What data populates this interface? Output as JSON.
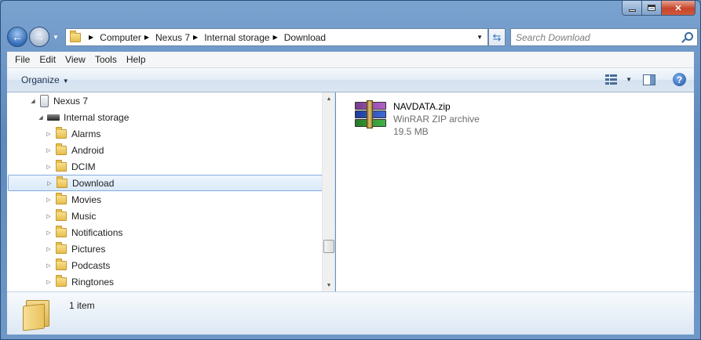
{
  "window": {
    "caption_buttons": [
      "minimize",
      "maximize",
      "close"
    ]
  },
  "address_bar": {
    "crumbs": [
      "Computer",
      "Nexus 7",
      "Internal storage",
      "Download"
    ]
  },
  "search": {
    "placeholder": "Search Download"
  },
  "menu": {
    "items": [
      "File",
      "Edit",
      "View",
      "Tools",
      "Help"
    ]
  },
  "toolbar": {
    "organize_label": "Organize"
  },
  "tree": {
    "device": "Nexus 7",
    "storage": "Internal storage",
    "folders": [
      "Alarms",
      "Android",
      "DCIM",
      "Download",
      "Movies",
      "Music",
      "Notifications",
      "Pictures",
      "Podcasts",
      "Ringtones"
    ],
    "selected": "Download"
  },
  "files": [
    {
      "name": "NAVDATA.zip",
      "type": "WinRAR ZIP archive",
      "size": "19.5 MB",
      "icon": "winrar-archive-icon"
    }
  ],
  "details": {
    "count": "1 item"
  },
  "colors": {
    "frame": "#6e98c8",
    "selection": "#d9e9fa",
    "close_button": "#c7452b"
  }
}
